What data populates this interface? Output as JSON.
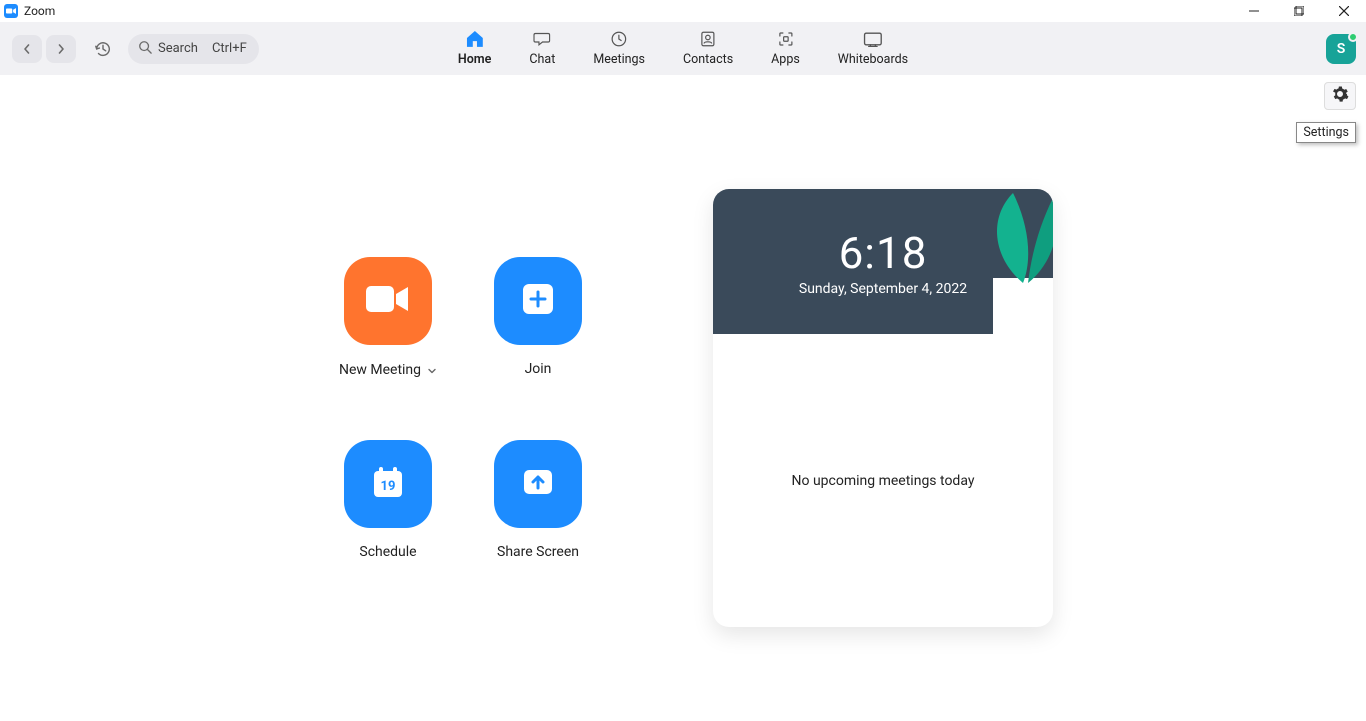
{
  "window": {
    "title": "Zoom"
  },
  "toolbar": {
    "search_label": "Search",
    "search_shortcut": "Ctrl+F"
  },
  "tabs": [
    {
      "label": "Home",
      "icon": "home",
      "active": true
    },
    {
      "label": "Chat",
      "icon": "chat",
      "active": false
    },
    {
      "label": "Meetings",
      "icon": "clock",
      "active": false
    },
    {
      "label": "Contacts",
      "icon": "contact",
      "active": false
    },
    {
      "label": "Apps",
      "icon": "apps",
      "active": false
    },
    {
      "label": "Whiteboards",
      "icon": "whiteboard",
      "active": false
    }
  ],
  "avatar": {
    "initial": "S"
  },
  "settings_tooltip": "Settings",
  "actions": {
    "new_meeting": "New Meeting",
    "join": "Join",
    "schedule": "Schedule",
    "share_screen": "Share Screen",
    "calendar_day": "19"
  },
  "panel": {
    "time": "6:18",
    "date": "Sunday, September 4, 2022",
    "empty": "No upcoming meetings today"
  }
}
